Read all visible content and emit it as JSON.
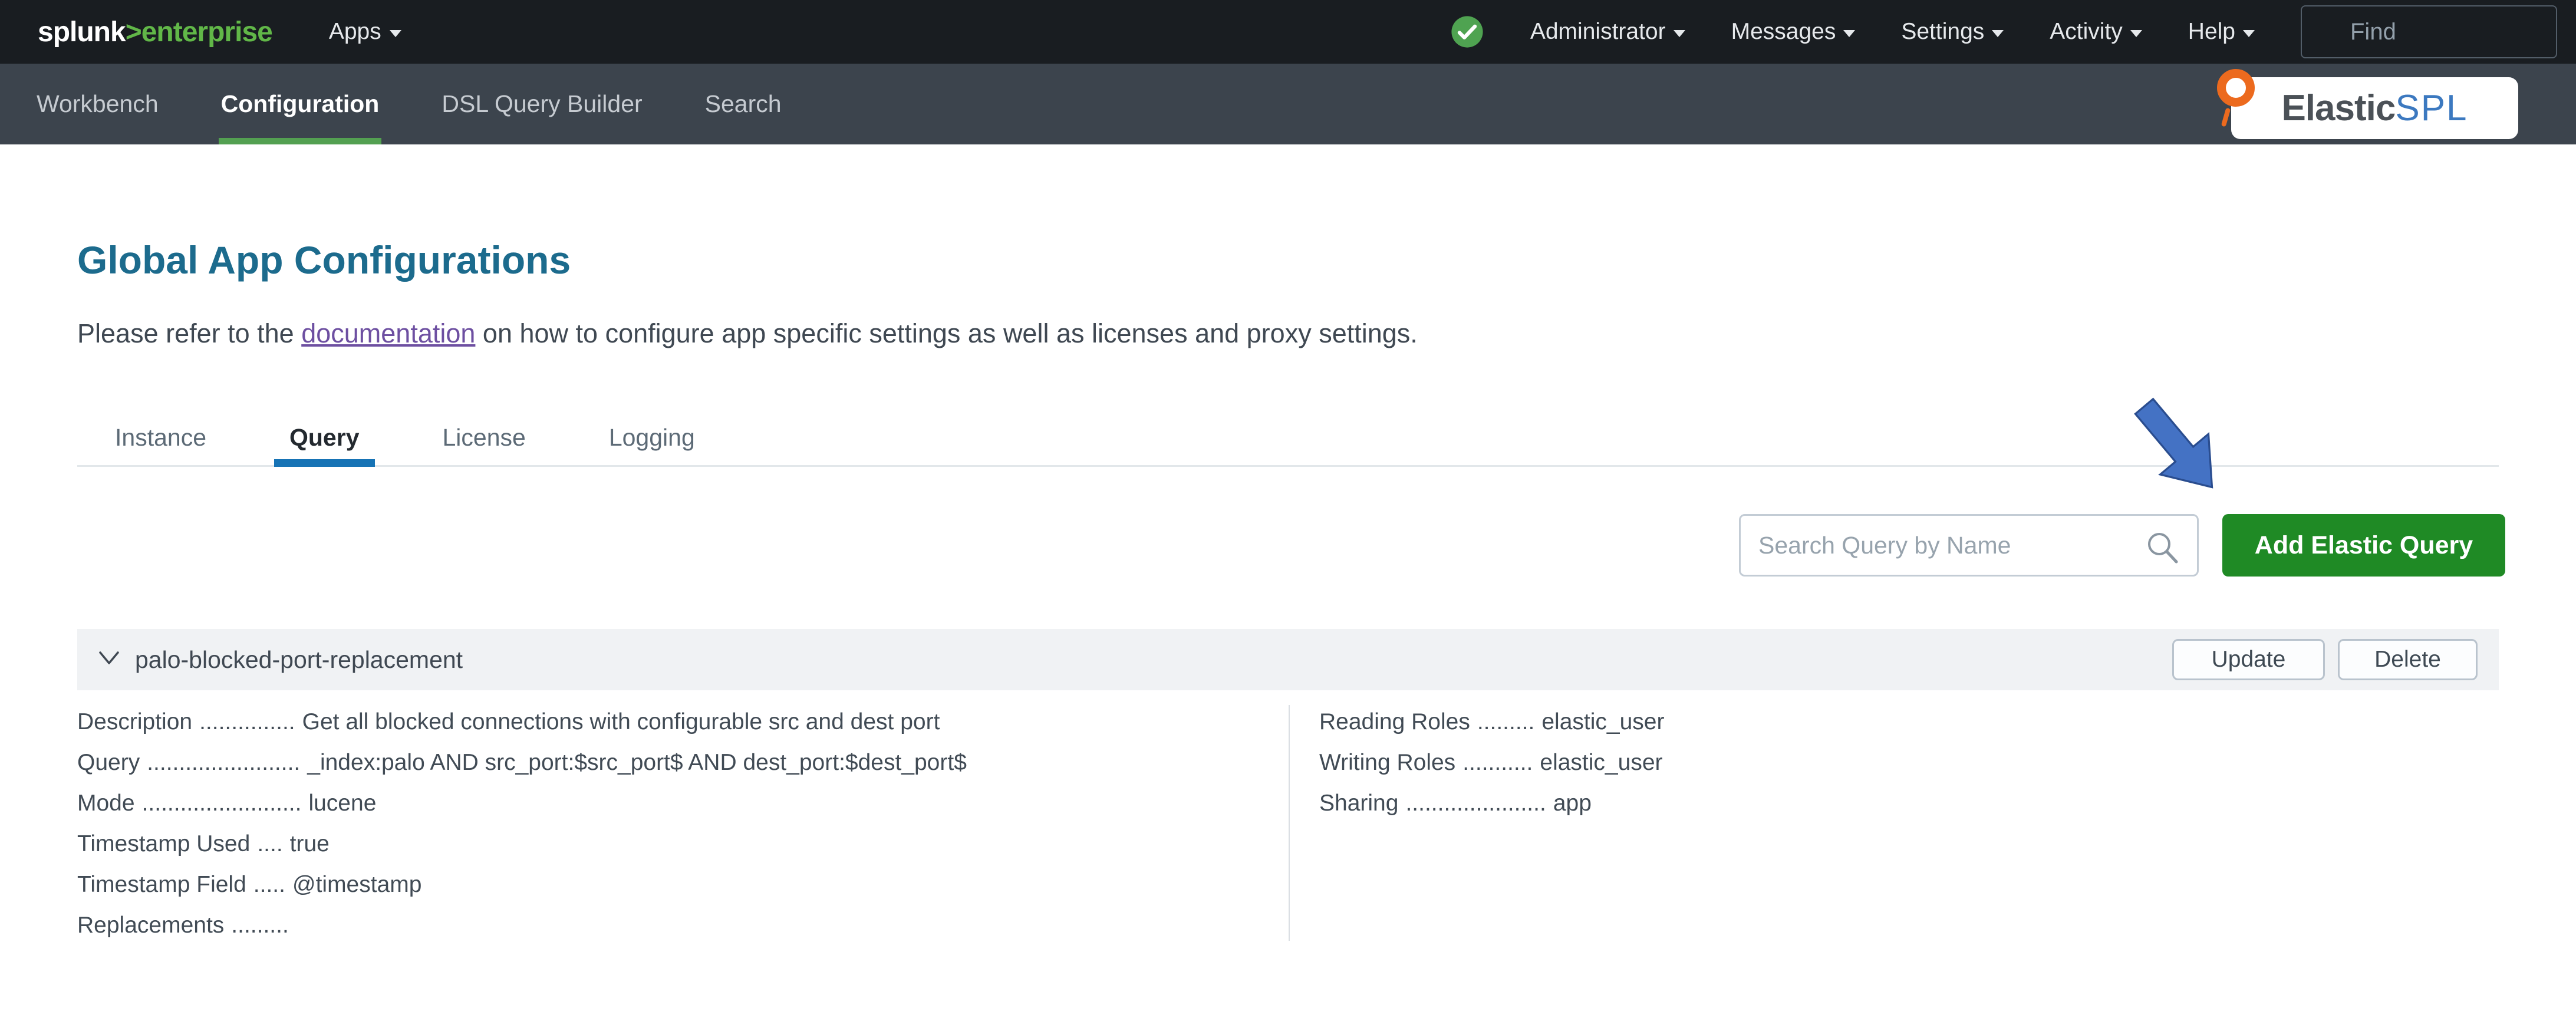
{
  "topbar": {
    "logo": {
      "word": "splunk",
      "chevron": ">",
      "product": "enterprise"
    },
    "apps": {
      "label": "Apps"
    },
    "status_icon": "health-check-circle",
    "menus": [
      {
        "label": "Administrator"
      },
      {
        "label": "Messages"
      },
      {
        "label": "Settings"
      },
      {
        "label": "Activity"
      },
      {
        "label": "Help"
      }
    ],
    "find": {
      "placeholder": "Find"
    }
  },
  "navbar": {
    "items": [
      {
        "label": "Workbench",
        "active": false
      },
      {
        "label": "Configuration",
        "active": true
      },
      {
        "label": "DSL Query Builder",
        "active": false
      },
      {
        "label": "Search",
        "active": false
      }
    ],
    "brand": {
      "part1": "Elastic",
      "part2": "SPL",
      "icon": "orange-dot-pin"
    }
  },
  "content": {
    "title": "Global App Configurations",
    "intro": {
      "before": "Please refer to the ",
      "link": "documentation",
      "after": " on how to configure app specific settings as well as licenses and proxy settings."
    },
    "tabs": [
      {
        "label": "Instance",
        "active": false
      },
      {
        "label": "Query",
        "active": true
      },
      {
        "label": "License",
        "active": false
      },
      {
        "label": "Logging",
        "active": false
      }
    ],
    "toolbar": {
      "search_placeholder": "Search Query by Name",
      "search_icon": "magnifier",
      "add_button": "Add Elastic Query",
      "annotation": "blue-arrow-pointing-to-add-button"
    },
    "query_row": {
      "expander_icon": "chevron-down",
      "name": "palo-blocked-port-replacement",
      "buttons": {
        "update": "Update",
        "delete": "Delete"
      },
      "details_left": [
        {
          "label": "Description",
          "dots": "...............",
          "value": "Get all blocked connections with configurable src and dest port"
        },
        {
          "label": "Query",
          "dots": "........................",
          "value": "_index:palo AND src_port:$src_port$ AND dest_port:$dest_port$"
        },
        {
          "label": "Mode",
          "dots": ".........................",
          "value": "lucene"
        },
        {
          "label": "Timestamp Used",
          "dots": "....",
          "value": "true"
        },
        {
          "label": "Timestamp Field",
          "dots": ".....",
          "value": "@timestamp"
        },
        {
          "label": "Replacements",
          "dots": ".........",
          "value": ""
        }
      ],
      "details_right": [
        {
          "label": "Reading Roles",
          "dots": ".........",
          "value": "elastic_user"
        },
        {
          "label": "Writing Roles",
          "dots": "...........",
          "value": "elastic_user"
        },
        {
          "label": "Sharing",
          "dots": "......................",
          "value": "app"
        }
      ]
    }
  },
  "colors": {
    "topbar_bg": "#191d21",
    "navbar_bg": "#3c444d",
    "splunk_green": "#61b748",
    "nav_active_underline": "#53a051",
    "status_green": "#4fa351",
    "heading_blue": "#1c6b8d",
    "link_purple": "#6d4fa1",
    "tab_active_underline": "#1673b5",
    "add_button_green": "#1f8a25",
    "annotation_arrow_blue": "#4472c4",
    "row_band_gray": "#f0f2f4",
    "brand_orange": "#ec6a1e",
    "brand_spl_blue": "#3c79c0"
  }
}
